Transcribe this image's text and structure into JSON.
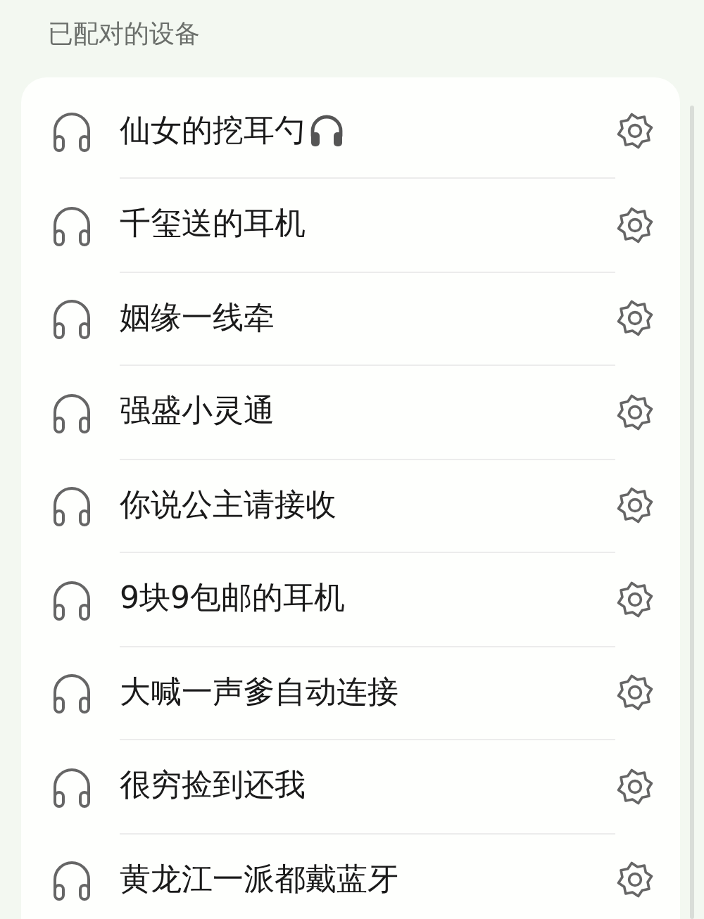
{
  "section_title": "已配对的设备",
  "devices": [
    {
      "name": "仙女的挖耳勺",
      "emoji_icon": true
    },
    {
      "name": "千玺送的耳机"
    },
    {
      "name": "姻缘一线牵"
    },
    {
      "name": "强盛小灵通"
    },
    {
      "name": "你说公主请接收"
    },
    {
      "name": "9块9包邮的耳机"
    },
    {
      "name": "大喊一声爹自动连接"
    },
    {
      "name": "很穷捡到还我"
    },
    {
      "name": "黄龙江一派都戴蓝牙"
    }
  ]
}
